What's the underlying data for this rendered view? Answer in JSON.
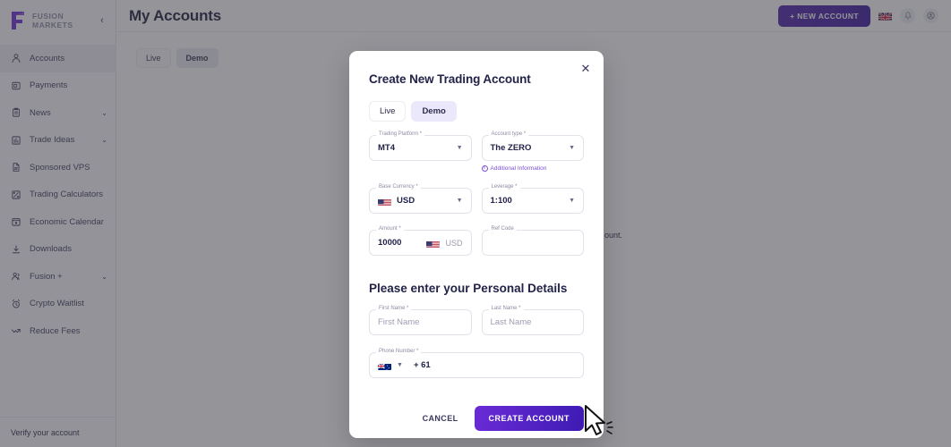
{
  "sidebar": {
    "logo_line1": "FUSION",
    "logo_line2": "MARKETS",
    "collapse_icon": "chevron-left-icon",
    "items": [
      {
        "label": "Accounts",
        "icon": "person-icon",
        "chevron": "",
        "active": true
      },
      {
        "label": "Payments",
        "icon": "card-icon",
        "chevron": "",
        "active": false
      },
      {
        "label": "News",
        "icon": "clipboard-icon",
        "chevron": "⌄",
        "active": false
      },
      {
        "label": "Trade Ideas",
        "icon": "bar-chart-icon",
        "chevron": "⌄",
        "active": false
      },
      {
        "label": "Sponsored VPS",
        "icon": "document-icon",
        "chevron": "",
        "active": false
      },
      {
        "label": "Trading Calculators",
        "icon": "calculator-icon",
        "chevron": "",
        "active": false
      },
      {
        "label": "Economic Calendar",
        "icon": "calendar-icon",
        "chevron": "",
        "active": false
      },
      {
        "label": "Downloads",
        "icon": "download-icon",
        "chevron": "",
        "active": false
      },
      {
        "label": "Fusion +",
        "icon": "people-icon",
        "chevron": "⌄",
        "active": false
      },
      {
        "label": "Crypto Waitlist",
        "icon": "alarm-clock-icon",
        "chevron": "",
        "active": false
      },
      {
        "label": "Reduce Fees",
        "icon": "trend-down-icon",
        "chevron": "",
        "active": false
      }
    ],
    "footer_label": "Verify your account"
  },
  "topbar": {
    "title": "My Accounts",
    "new_account_label": "+ NEW ACCOUNT",
    "flag": "uk-flag-icon",
    "bell_icon": "bell-icon",
    "avatar_icon": "avatar-icon"
  },
  "page": {
    "tabs": [
      {
        "label": "Live",
        "selected": false
      },
      {
        "label": "Demo",
        "selected": true
      }
    ],
    "background_text_fragment": "ount."
  },
  "modal": {
    "title": "Create New Trading Account",
    "close_icon": "close-icon",
    "tabs": [
      {
        "label": "Live",
        "selected": false
      },
      {
        "label": "Demo",
        "selected": true
      }
    ],
    "fields": {
      "trading_platform": {
        "label": "Trading Platform *",
        "value": "MT4"
      },
      "account_type": {
        "label": "Account type *",
        "value": "The ZERO"
      },
      "base_currency": {
        "label": "Base Currency *",
        "value": "USD",
        "flag": "us-flag-icon"
      },
      "leverage": {
        "label": "Leverage *",
        "value": "1:100"
      },
      "amount": {
        "label": "Amount *",
        "value": "10000",
        "suffix": "USD",
        "flag": "us-flag-icon"
      },
      "ref_code": {
        "label": "Ref Code",
        "value": ""
      },
      "first_name": {
        "label": "First Name *",
        "value": "",
        "placeholder": "First Name"
      },
      "last_name": {
        "label": "Last Name *",
        "value": "",
        "placeholder": "Last Name"
      },
      "phone_number": {
        "label": "Phone Number *",
        "value": "+ 61",
        "flag": "au-flag-icon"
      }
    },
    "additional_info_label": "Additional Information",
    "personal_details_title": "Please enter your Personal Details",
    "cancel_label": "CANCEL",
    "create_label": "CREATE ACCOUNT"
  },
  "colors": {
    "brand_purple": "#6a2bd6",
    "brand_deep": "#3d1bb3",
    "text_dark": "#23234a",
    "muted": "#8b8ba6",
    "selected_chip": "#ece8fb"
  }
}
